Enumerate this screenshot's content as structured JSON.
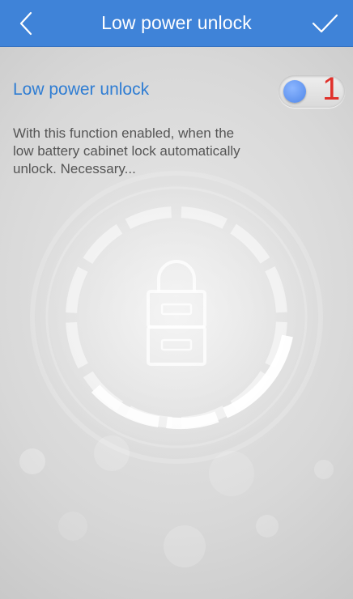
{
  "header": {
    "title": "Low power unlock",
    "back_icon": "chevron-left-icon",
    "confirm_icon": "checkmark-icon"
  },
  "setting": {
    "label": "Low power unlock",
    "toggle_state": "off",
    "toggle_mark": "1",
    "description": "With this function enabled, when the low battery cabinet lock automatically unlock. Necessary..."
  },
  "illustration": {
    "icon": "locked-cabinet-icon"
  },
  "colors": {
    "header_bg": "#3f83d8",
    "accent_text": "#2f7dd3",
    "toggle_knob": "#5a8fe8",
    "mark": "#e0302a"
  }
}
